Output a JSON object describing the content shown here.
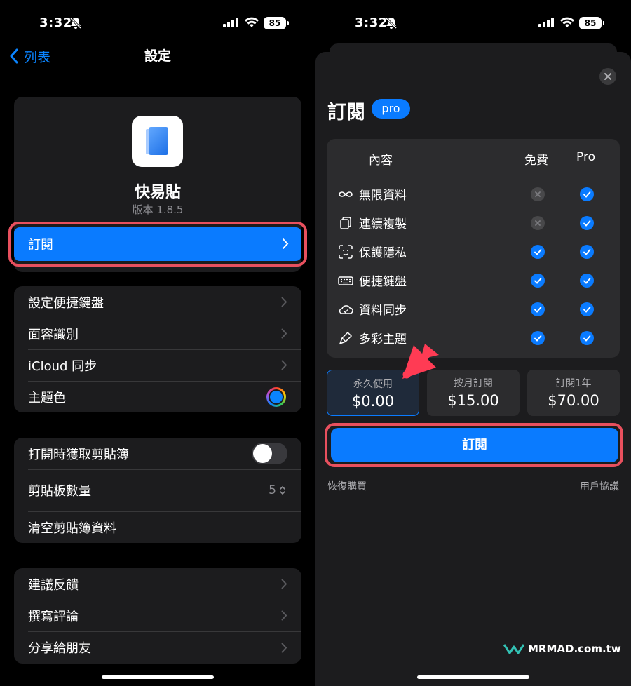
{
  "left": {
    "status": {
      "time": "3:32",
      "battery": "85"
    },
    "nav": {
      "back": "列表",
      "title": "設定"
    },
    "app": {
      "name": "快易貼",
      "version": "版本 1.8.5"
    },
    "subscribe": "訂閱",
    "group1": [
      "設定便捷鍵盤",
      "面容識別",
      "iCloud 同步",
      "主題色"
    ],
    "group2": {
      "open_fetch": "打開時獲取剪貼簿",
      "count_label": "剪貼板數量",
      "count_value": "5",
      "clear": "清空剪貼簿資料"
    },
    "group3": [
      "建議反饋",
      "撰寫評論",
      "分享給朋友"
    ],
    "theme_color": "#0a84ff"
  },
  "right": {
    "status": {
      "time": "3:32",
      "battery": "85"
    },
    "title": "訂閱",
    "badge": "pro",
    "table": {
      "headers": [
        "內容",
        "免費",
        "Pro"
      ],
      "features": [
        {
          "label": "無限資料",
          "icon": "infinity-icon",
          "free": false,
          "pro": true
        },
        {
          "label": "連續複製",
          "icon": "copy-icon",
          "free": false,
          "pro": true
        },
        {
          "label": "保護隱私",
          "icon": "faceid-icon",
          "free": true,
          "pro": true
        },
        {
          "label": "便捷鍵盤",
          "icon": "keyboard-icon",
          "free": true,
          "pro": true
        },
        {
          "label": "資料同步",
          "icon": "cloud-icon",
          "free": true,
          "pro": true
        },
        {
          "label": "多彩主題",
          "icon": "brush-icon",
          "free": true,
          "pro": true
        }
      ]
    },
    "plans": [
      {
        "name": "永久使用",
        "price": "$0.00"
      },
      {
        "name": "按月訂閱",
        "price": "$15.00"
      },
      {
        "name": "訂閱1年",
        "price": "$70.00"
      }
    ],
    "buy": "訂閱",
    "restore": "恢復購買",
    "terms": "用戶協議",
    "watermark": "MRMAD.com.tw",
    "accent": "#0a7bff",
    "highlight": "#e8505e"
  }
}
